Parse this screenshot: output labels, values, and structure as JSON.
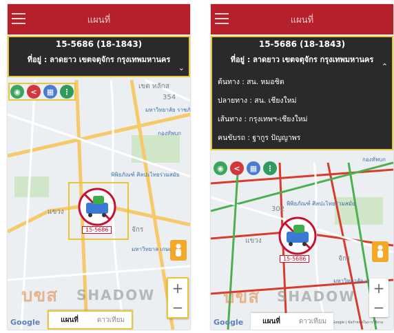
{
  "left": {
    "title": "แผนที่",
    "plate": "15-5686 (18-1843)",
    "address": "ที่อยู่ : ลาดยาว เขตจตุจักร กรุงเทพมหานคร",
    "chevron": "⌄",
    "vehicle_plate": "15-5686",
    "map_labels": [
      "เขต หลักส",
      "354",
      "มหาวิทยาลัย ราชภัฏ",
      "กองทัพบก",
      "พิพิธภัณฑ์ ศิลปะไทยร่วมสมัย",
      "แขวง",
      "จักร",
      "มหาวิทยาล เกษตร"
    ],
    "watermark": "บขส",
    "watermark2": "SHADOW",
    "google": "Google",
    "maptype_map": "แผนที่",
    "maptype_satellite": "ดาวเทียม",
    "zoom_in": "+",
    "zoom_out": "−"
  },
  "right": {
    "title": "แผนที่",
    "plate": "15-5686 (18-1843)",
    "address": "ที่อยู่ : ลาดยาว เขตจตุจักร กรุงเทพมหานคร",
    "chevron": "⌃",
    "details": [
      "ต้นทาง : สน. หมอชิต",
      "ปลายทาง : สน. เชียงใหม่",
      "เส้นทาง : กรุงเทพฯ-เชียงใหม่",
      "คนขับรถ : ฐากูร ปัญญาพร"
    ],
    "vehicle_plate": "15-5686",
    "map_labels": [
      "กองทัพบก",
      "พิพิธภัณฑ์ ศิลปะไทยร่วมสมัย",
      "302",
      "แขวง",
      "จักร",
      "มหาวิทยาลัย เกษตร"
    ],
    "watermark": "บขส",
    "watermark2": "SHADOW",
    "google": "Google",
    "copyright": "ข้อมูลแผนที่ ©2019 Google | ข้อกำหนดในการใช้งาน",
    "maptype_map": "แผนที่",
    "maptype_satellite": "ดาวเทียม",
    "zoom_in": "+",
    "zoom_out": "−"
  },
  "colors": {
    "appbar": "#b5202a",
    "panel": "#2a2a2a",
    "highlight": "#e9c53a",
    "plate": "#c8102e"
  },
  "icons": [
    "menu-icon",
    "map-pin-icon",
    "share-icon",
    "grid-icon",
    "traffic-light-icon",
    "bus-icon",
    "person-icon",
    "zoom-in-icon",
    "zoom-out-icon"
  ]
}
